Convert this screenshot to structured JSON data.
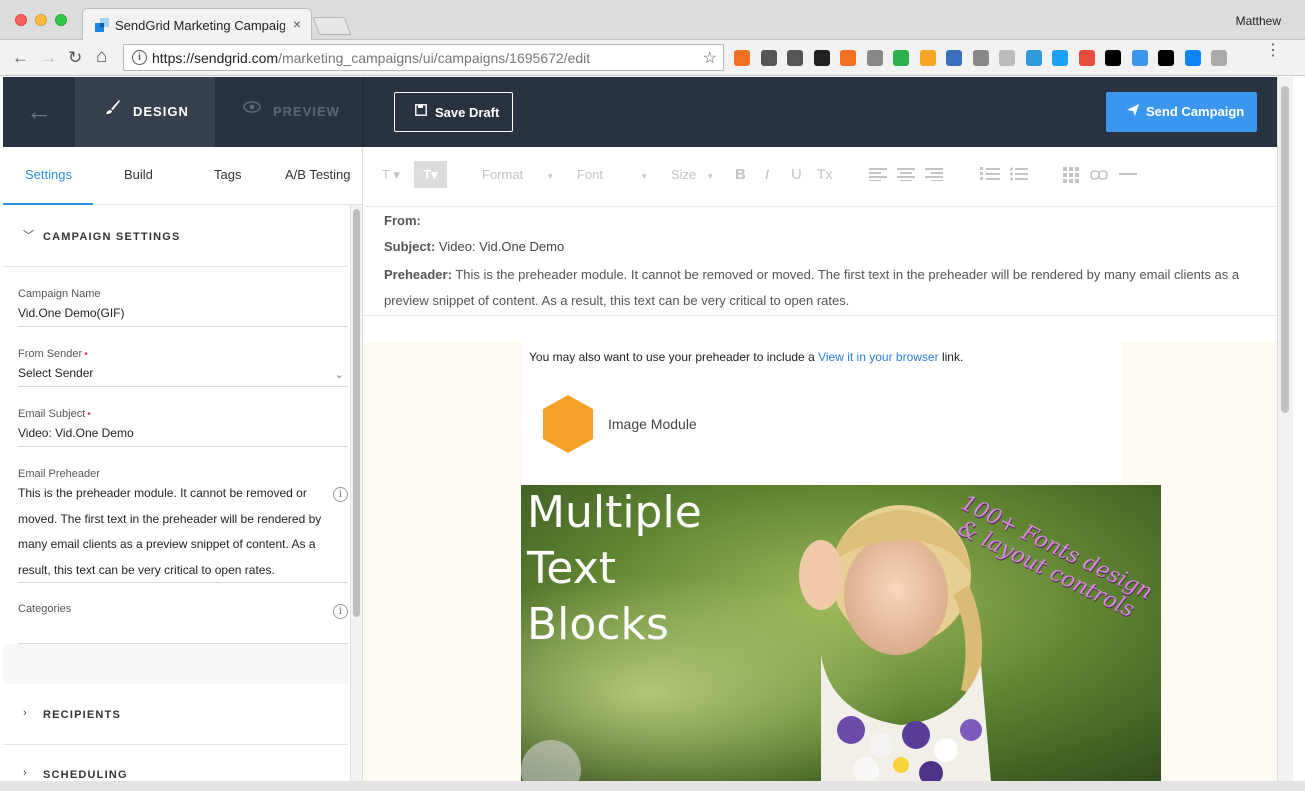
{
  "browser": {
    "tab_title": "SendGrid Marketing Campaigns",
    "tab_close": "×",
    "profile_name": "Matthew",
    "url_host": "https://sendgrid.com",
    "url_path": "/marketing_campaigns/ui/campaigns/1695672/edit",
    "info_glyph": "i",
    "star_glyph": "☆",
    "back_glyph": "←",
    "forward_glyph": "→",
    "reload_glyph": "↻",
    "home_glyph": "⌂",
    "menu_glyph": "⋮",
    "extensions": [
      "#f37021",
      "#555555",
      "#555555",
      "#222222",
      "#f37021",
      "#888888",
      "#2bb24c",
      "#f5a623",
      "#3b6fbf",
      "#888888",
      "#bbbbbb",
      "#2d9cdb",
      "#1da1f2",
      "#e74c3c",
      "#000000",
      "#3b96f0",
      "#000000",
      "#0a84ff",
      "#aaaaaa"
    ]
  },
  "header": {
    "back_glyph": "←",
    "design_label": "DESIGN",
    "design_icon": "paintbrush-icon",
    "preview_label": "PREVIEW",
    "preview_icon": "eye-icon",
    "save_draft_label": "Save Draft",
    "save_icon": "floppy-icon",
    "send_label": "Send Campaign",
    "send_icon": "paper-plane-icon",
    "send_color": "#3b96f0",
    "header_bg": "#293241"
  },
  "sidebar": {
    "tabs": [
      {
        "label": "Settings",
        "active": true
      },
      {
        "label": "Build",
        "active": false
      },
      {
        "label": "Tags",
        "active": false
      },
      {
        "label": "A/B Testing",
        "active": false
      }
    ],
    "campaign_settings_title": "CAMPAIGN SETTINGS",
    "fields": {
      "campaign_name_label": "Campaign Name",
      "campaign_name_value": "Vid.One Demo(GIF)",
      "from_sender_label": "From Sender",
      "from_sender_value": "Select Sender",
      "email_subject_label": "Email Subject",
      "email_subject_value": "Video: Vid.One Demo",
      "email_preheader_label": "Email Preheader",
      "email_preheader_value": "This is the preheader module. It cannot be removed or moved. The first text in the preheader will be rendered by many email clients as a preview snippet of content. As a result, this text can be very critical to open rates.",
      "categories_label": "Categories",
      "required_mark": "•"
    },
    "recipients_title": "RECIPIENTS",
    "scheduling_title": "SCHEDULING"
  },
  "toolbar": {
    "text_style": "T",
    "text_style_selected": "T",
    "format_label": "Format",
    "font_label": "Font",
    "size_label": "Size",
    "bold": "B",
    "italic": "I",
    "underline": "U",
    "clear": "Tx"
  },
  "email": {
    "from_label": "From:",
    "from_value": "",
    "subject_label": "Subject:",
    "subject_value": "Video: Vid.One Demo",
    "preheader_label": "Preheader:",
    "preheader_value": "This is the preheader module. It cannot be removed or moved. The first text in the preheader will be rendered by many email clients as a preview snippet of content. As a result, this text can be very critical to open rates.",
    "preheader_line_prefix": "You may also want to use your preheader to include a",
    "preheader_link": "View it in your browser",
    "preheader_line_suffix": "link.",
    "image_module_label": "Image Module",
    "hero_line1": "Multiple",
    "hero_line2": "Text",
    "hero_line3": "Blocks",
    "hero_promo": "100+ Fonts design & layout controls"
  }
}
